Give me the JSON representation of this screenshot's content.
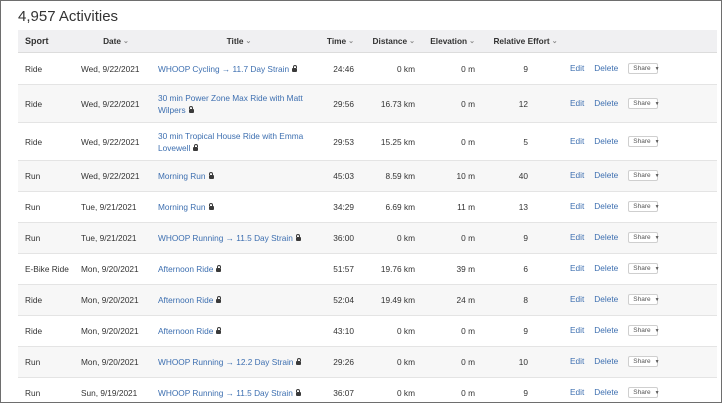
{
  "page": {
    "title": "4,957 Activities"
  },
  "columns": {
    "sport": "Sport",
    "date": "Date",
    "title": "Title",
    "time": "Time",
    "distance": "Distance",
    "elevation": "Elevation",
    "effort": "Relative Effort"
  },
  "actions": {
    "edit": "Edit",
    "delete": "Delete",
    "share": "Share"
  },
  "rows": [
    {
      "sport": "Ride",
      "date": "Wed, 9/22/2021",
      "title": "WHOOP Cycling → 11.7 Day Strain",
      "time": "24:46",
      "distance": "0 km",
      "elevation": "0 m",
      "effort": "9",
      "private": true
    },
    {
      "sport": "Ride",
      "date": "Wed, 9/22/2021",
      "title": "30 min Power Zone Max Ride with Matt Wilpers",
      "time": "29:56",
      "distance": "16.73 km",
      "elevation": "0 m",
      "effort": "12",
      "private": true
    },
    {
      "sport": "Ride",
      "date": "Wed, 9/22/2021",
      "title": "30 min Tropical House Ride with Emma Lovewell",
      "time": "29:53",
      "distance": "15.25 km",
      "elevation": "0 m",
      "effort": "5",
      "private": true
    },
    {
      "sport": "Run",
      "date": "Wed, 9/22/2021",
      "title": "Morning Run",
      "time": "45:03",
      "distance": "8.59 km",
      "elevation": "10 m",
      "effort": "40",
      "private": true
    },
    {
      "sport": "Run",
      "date": "Tue, 9/21/2021",
      "title": "Morning Run",
      "time": "34:29",
      "distance": "6.69 km",
      "elevation": "11 m",
      "effort": "13",
      "private": true
    },
    {
      "sport": "Run",
      "date": "Tue, 9/21/2021",
      "title": "WHOOP Running → 11.5 Day Strain",
      "time": "36:00",
      "distance": "0 km",
      "elevation": "0 m",
      "effort": "9",
      "private": true
    },
    {
      "sport": "E-Bike Ride",
      "date": "Mon, 9/20/2021",
      "title": "Afternoon Ride",
      "time": "51:57",
      "distance": "19.76 km",
      "elevation": "39 m",
      "effort": "6",
      "private": true
    },
    {
      "sport": "Ride",
      "date": "Mon, 9/20/2021",
      "title": "Afternoon Ride",
      "time": "52:04",
      "distance": "19.49 km",
      "elevation": "24 m",
      "effort": "8",
      "private": true
    },
    {
      "sport": "Ride",
      "date": "Mon, 9/20/2021",
      "title": "Afternoon Ride",
      "time": "43:10",
      "distance": "0 km",
      "elevation": "0 m",
      "effort": "9",
      "private": true
    },
    {
      "sport": "Run",
      "date": "Mon, 9/20/2021",
      "title": "WHOOP Running → 12.2 Day Strain",
      "time": "29:26",
      "distance": "0 km",
      "elevation": "0 m",
      "effort": "10",
      "private": true
    },
    {
      "sport": "Run",
      "date": "Sun, 9/19/2021",
      "title": "WHOOP Running → 11.5 Day Strain",
      "time": "36:07",
      "distance": "0 km",
      "elevation": "0 m",
      "effort": "9",
      "private": true
    }
  ],
  "colors": {
    "link": "#3d6fb0",
    "header_bg": "#f0f0f2",
    "stripe": "#f7f7f7"
  },
  "icons": {
    "private": "lock-icon",
    "sort": "chevron-down-icon",
    "share": "triangle-down-icon"
  }
}
